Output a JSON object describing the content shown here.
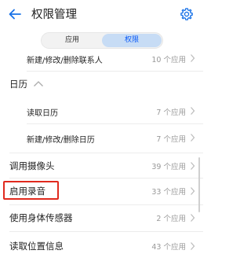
{
  "header": {
    "title": "权限管理"
  },
  "segment": {
    "tabs": [
      "应用",
      "权限"
    ],
    "active_index": 1,
    "active_color": "#0a59f7"
  },
  "rows": [
    {
      "label": "新建/修改/删除联系人",
      "count": "10 个应用"
    },
    {
      "label": "读取日历",
      "count": "7 个应用"
    },
    {
      "label": "新建/修改/删除日历",
      "count": "7 个应用"
    },
    {
      "label": "调用摄像头",
      "count": "39 个应用"
    },
    {
      "label": "启用录音",
      "count": "33 个应用"
    },
    {
      "label": "使用身体传感器",
      "count": "2 个应用"
    },
    {
      "label": "读取位置信息",
      "count": "43 个应用"
    }
  ],
  "group": {
    "label": "日历",
    "expanded": true
  },
  "highlight_color": "#e02a1e"
}
